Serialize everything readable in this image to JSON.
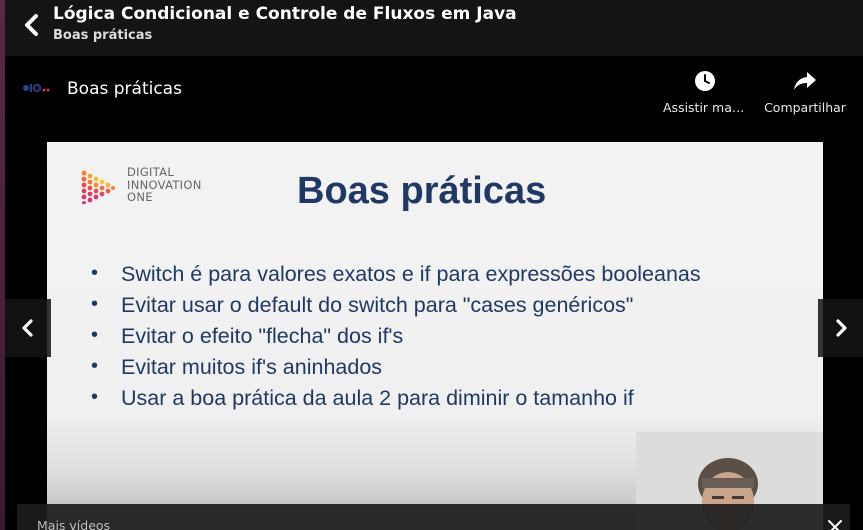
{
  "course": {
    "title": "Lógica Condicional e Controle de Fluxos em Java",
    "lesson": "Boas práticas"
  },
  "video": {
    "title": "Boas práticas",
    "actions": [
      {
        "label": "Assistir mais tarde",
        "icon": "clock-icon"
      },
      {
        "label": "Compartilhar",
        "icon": "share-icon"
      }
    ]
  },
  "slide": {
    "brand": [
      "DIGITAL",
      "INNOVATION",
      "ONE"
    ],
    "title": "Boas práticas",
    "bullets": [
      "Switch é para valores exatos e if para expressões booleanas",
      "Evitar usar o default do switch para \"cases genéricos\"",
      "Evitar o efeito \"flecha\" dos if's",
      "Evitar muitos if's aninhados",
      "Usar a boa prática da aula 2 para diminir o tamanho if"
    ]
  },
  "more_videos": {
    "label": "Mais vídeos"
  },
  "colors": {
    "slide_text": "#203864",
    "topbar": "#141414",
    "accent_red": "#e23a3a"
  }
}
